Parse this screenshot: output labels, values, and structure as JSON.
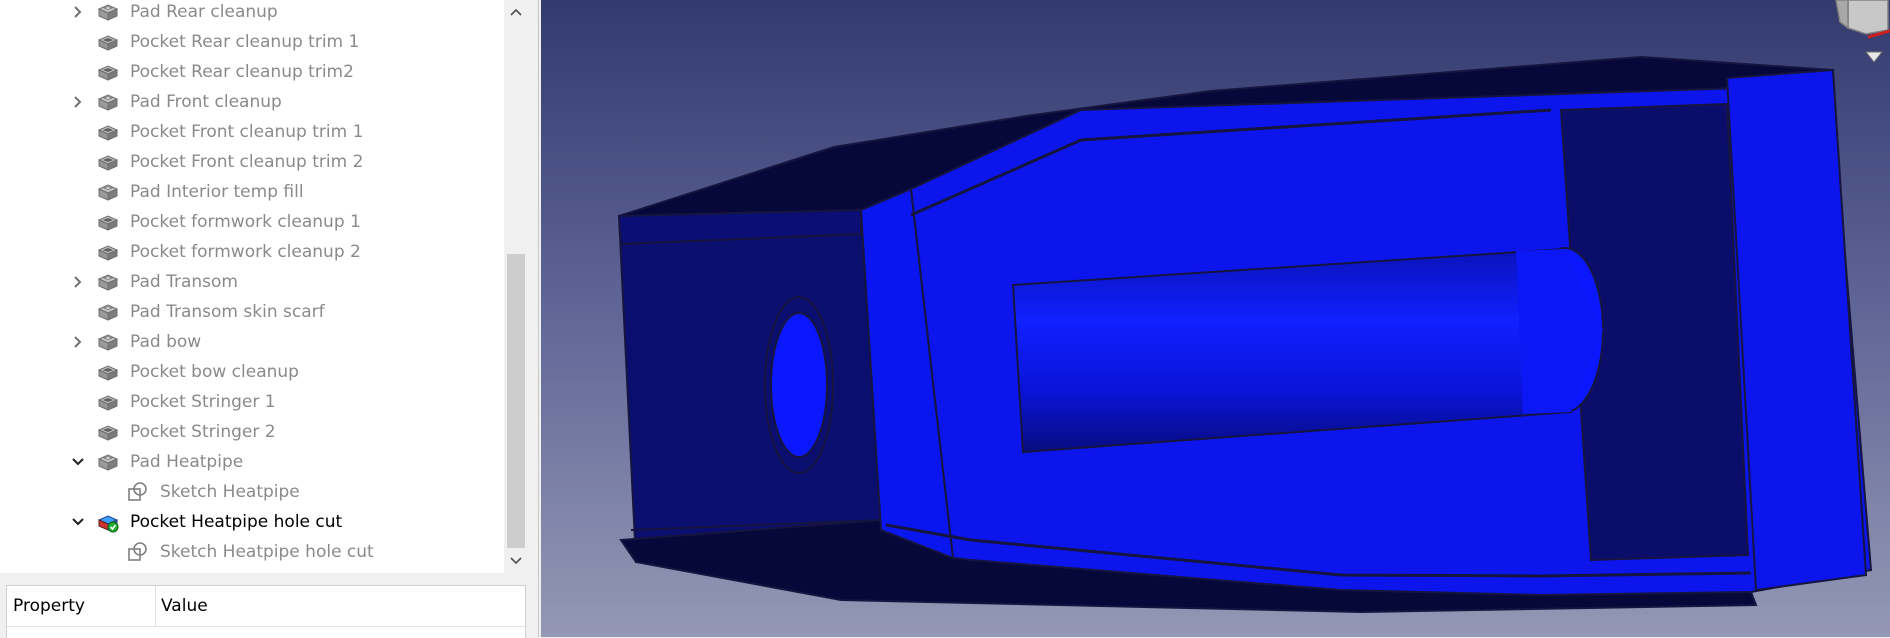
{
  "tree": {
    "items": [
      {
        "label": "Pad Rear cleanup",
        "expander": "collapsed",
        "icon": "pad-icon",
        "active": false,
        "indent": 0
      },
      {
        "label": "Pocket Rear cleanup trim 1",
        "expander": "none",
        "icon": "pocket-icon",
        "active": false,
        "indent": 0
      },
      {
        "label": "Pocket Rear cleanup trim2",
        "expander": "none",
        "icon": "pocket-icon",
        "active": false,
        "indent": 0
      },
      {
        "label": "Pad Front cleanup",
        "expander": "collapsed",
        "icon": "pad-icon",
        "active": false,
        "indent": 0
      },
      {
        "label": "Pocket Front cleanup trim 1",
        "expander": "none",
        "icon": "pocket-icon",
        "active": false,
        "indent": 0
      },
      {
        "label": "Pocket Front cleanup trim 2",
        "expander": "none",
        "icon": "pocket-icon",
        "active": false,
        "indent": 0
      },
      {
        "label": "Pad Interior temp fill",
        "expander": "none",
        "icon": "pad-icon",
        "active": false,
        "indent": 0
      },
      {
        "label": "Pocket formwork cleanup 1",
        "expander": "none",
        "icon": "pocket-icon",
        "active": false,
        "indent": 0
      },
      {
        "label": "Pocket formwork cleanup 2",
        "expander": "none",
        "icon": "pocket-icon",
        "active": false,
        "indent": 0
      },
      {
        "label": "Pad Transom",
        "expander": "collapsed",
        "icon": "pad-icon",
        "active": false,
        "indent": 0
      },
      {
        "label": "Pad Transom skin scarf",
        "expander": "none",
        "icon": "pad-icon",
        "active": false,
        "indent": 0
      },
      {
        "label": "Pad bow",
        "expander": "collapsed",
        "icon": "pad-icon",
        "active": false,
        "indent": 0
      },
      {
        "label": "Pocket bow cleanup",
        "expander": "none",
        "icon": "pocket-icon",
        "active": false,
        "indent": 0
      },
      {
        "label": "Pocket Stringer 1",
        "expander": "none",
        "icon": "pocket-icon",
        "active": false,
        "indent": 0
      },
      {
        "label": "Pocket Stringer 2",
        "expander": "none",
        "icon": "pocket-icon",
        "active": false,
        "indent": 0
      },
      {
        "label": "Pad Heatpipe",
        "expander": "expanded",
        "icon": "pad-icon",
        "active": false,
        "indent": 0
      },
      {
        "label": "Sketch Heatpipe",
        "expander": "none",
        "icon": "sketch-icon",
        "active": false,
        "indent": 1
      },
      {
        "label": "Pocket Heatpipe hole cut",
        "expander": "expanded",
        "icon": "active-pocket-icon",
        "active": true,
        "indent": 0
      },
      {
        "label": "Sketch Heatpipe hole cut",
        "expander": "none",
        "icon": "sketch-icon",
        "active": false,
        "indent": 1
      }
    ]
  },
  "property_panel": {
    "col_property": "Property",
    "col_value": "Value"
  },
  "colors": {
    "face_blue": "#0a14ee",
    "face_dark": "#0a0e6a",
    "face_darker": "#07093e",
    "edge": "#1a1a40"
  }
}
